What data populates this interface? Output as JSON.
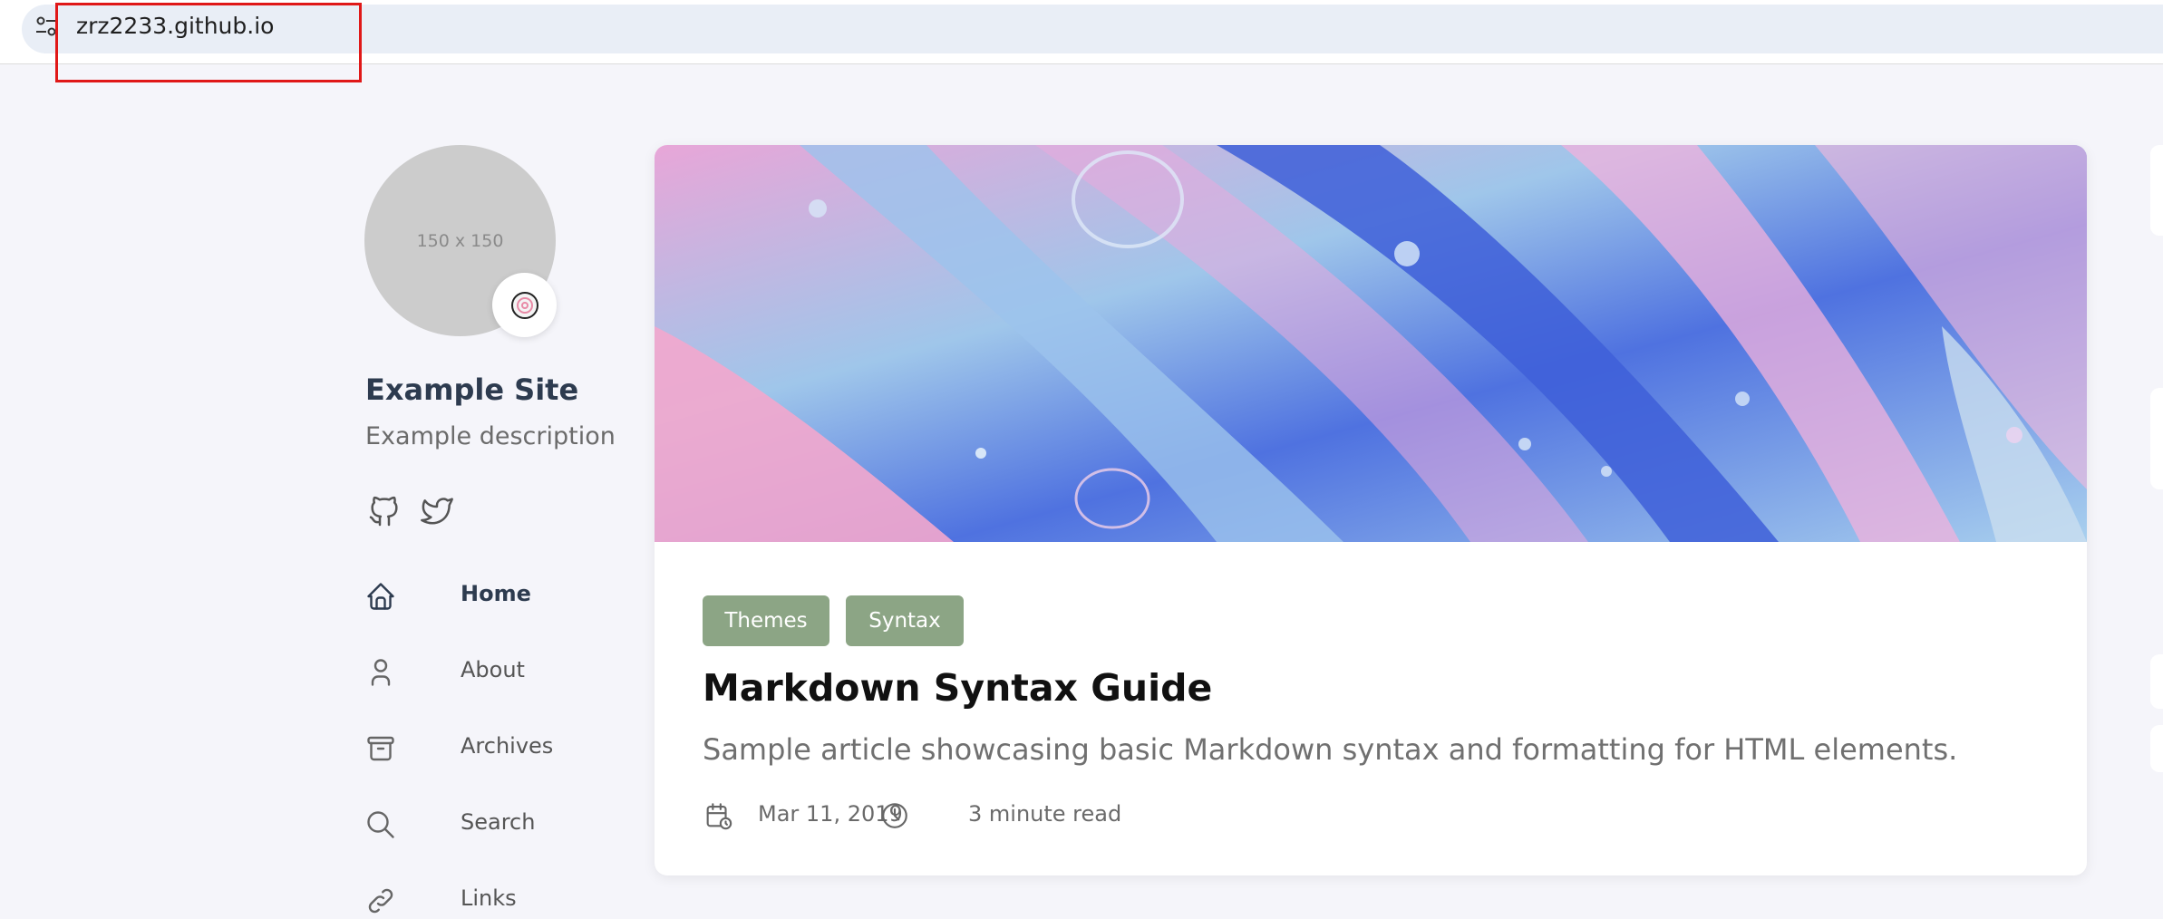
{
  "browser": {
    "url": "zrz2233.github.io",
    "site_info_icon": "tune-icon"
  },
  "sidebar": {
    "avatar_placeholder": "150 x 150",
    "emoji": "🍥",
    "site_name": "Example Site",
    "site_description": "Example description",
    "social": [
      {
        "icon": "github-icon"
      },
      {
        "icon": "twitter-icon"
      }
    ],
    "menu": [
      {
        "label": "Home",
        "icon": "home-icon",
        "active": true
      },
      {
        "label": "About",
        "icon": "user-icon",
        "active": false
      },
      {
        "label": "Archives",
        "icon": "archive-icon",
        "active": false
      },
      {
        "label": "Search",
        "icon": "search-icon",
        "active": false
      },
      {
        "label": "Links",
        "icon": "link-icon",
        "active": false
      }
    ]
  },
  "article": {
    "tags": [
      "Themes",
      "Syntax"
    ],
    "title": "Markdown Syntax Guide",
    "subtitle": "Sample article showcasing basic Markdown syntax and formatting for HTML elements.",
    "date": "Mar 11, 2019",
    "read_time": "3 minute read"
  },
  "colors": {
    "tag_bg": "#8ca585",
    "highlight": "#e01818"
  }
}
